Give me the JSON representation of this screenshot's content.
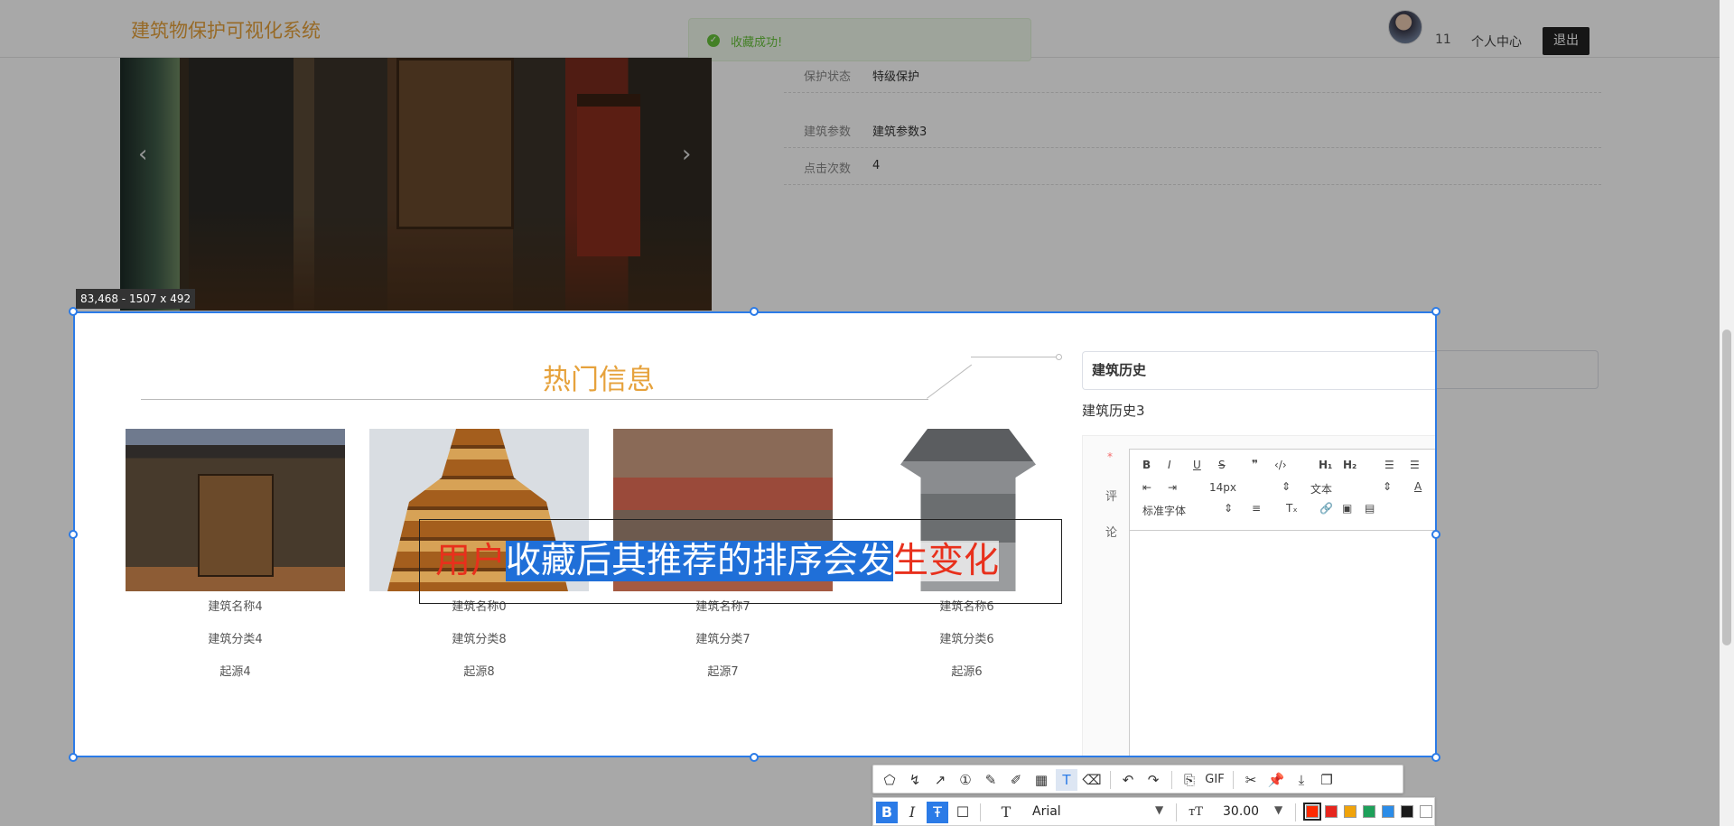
{
  "app": {
    "title": "建筑物保护可视化系统"
  },
  "toast": {
    "message": "收藏成功!"
  },
  "user": {
    "id": "11",
    "center_label": "个人中心",
    "logout_label": "退出"
  },
  "carousel": {
    "prev": "‹",
    "next": "›"
  },
  "info": [
    {
      "key": "保护状态",
      "value": "特级保护"
    },
    {
      "key": "建筑参数",
      "value": "建筑参数3"
    },
    {
      "key": "点击次数",
      "value": "4"
    }
  ],
  "hot": {
    "title": "热门信息",
    "cards": [
      {
        "name": "建筑名称4",
        "category": "建筑分类4",
        "origin": "起源4"
      },
      {
        "name": "建筑名称0",
        "category": "建筑分类8",
        "origin": "起源8"
      },
      {
        "name": "建筑名称7",
        "category": "建筑分类7",
        "origin": "起源7"
      },
      {
        "name": "建筑名称6",
        "category": "建筑分类6",
        "origin": "起源6"
      }
    ]
  },
  "history": {
    "label": "建筑历史",
    "text": "建筑历史3"
  },
  "comment": {
    "required_mark": "*",
    "label_chars": [
      "评",
      "论"
    ],
    "editor": {
      "size_value": "14px",
      "header_value": "文本",
      "font_value": "标准字体"
    }
  },
  "capture": {
    "dims": "83,468 - 1507 x 492",
    "annotation_parts": [
      "用户",
      "收藏后其推荐的排序会发",
      "生变化"
    ]
  },
  "screenshot_toolbar": {
    "gif_label": "GIF",
    "font_name": "Arial",
    "font_size": "30.00",
    "palette": [
      "#ff2a00",
      "#e6261f",
      "#f0a30a",
      "#1ea05a",
      "#2b8ce8",
      "#1a1a1a",
      "#ffffff"
    ],
    "selected_color": "#ff2a00"
  }
}
